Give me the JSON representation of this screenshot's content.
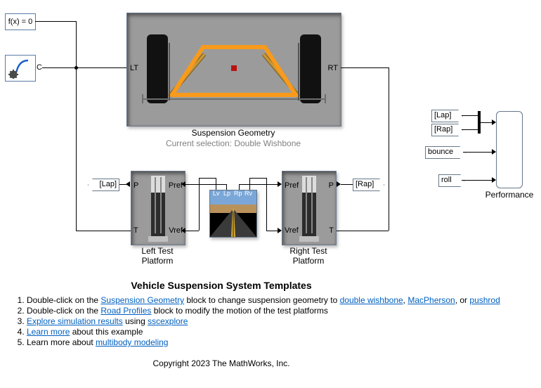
{
  "sources": {
    "fx_label": "f(x) = 0",
    "solver_tag": "C"
  },
  "geometry": {
    "caption": "Suspension Geometry",
    "subcaption": "Current selection: Double Wishbone",
    "port_left": "LT",
    "port_right": "RT"
  },
  "platforms": {
    "left": {
      "caption": "Left Test\nPlatform",
      "port_P": "P",
      "port_T": "T",
      "port_Pref": "Pref",
      "port_Vref": "Vref"
    },
    "right": {
      "caption": "Right Test\nPlatform",
      "port_P": "P",
      "port_T": "T",
      "port_Pref": "Pref",
      "port_Vref": "Vref"
    }
  },
  "road": {
    "port_Lv": "Lv",
    "port_Lp": "Lp",
    "port_Rp": "Rp",
    "port_Rv": "Rv"
  },
  "tags": {
    "lap_from": "[Lap]",
    "rap_from": "[Rap]",
    "lap_goto": "[Lap]",
    "rap_goto": "[Rap]",
    "bounce_goto": "bounce",
    "roll_goto": "roll"
  },
  "scope": {
    "caption": "Performance"
  },
  "help": {
    "title": "Vehicle Suspension System Templates",
    "lines": [
      {
        "pre": "Double-click on the ",
        "link": "Suspension Geometry",
        "mid": " block to change suspension geometry to ",
        "link2": "double wishbone",
        "mid2": ", ",
        "link3": "MacPherson",
        "mid3": ", or ",
        "link4": "pushrod",
        "post": ""
      },
      {
        "pre": "Double-click on the ",
        "link": "Road Profiles",
        "post": " block to modify the motion of the test platforms"
      },
      {
        "link": "Explore simulation results",
        "mid": " using ",
        "link2": "sscexplore",
        "post": ""
      },
      {
        "link": "Learn more",
        "post": " about this example"
      },
      {
        "pre": "Learn more about ",
        "link": "multibody modeling",
        "post": ""
      }
    ],
    "copyright": "Copyright 2023 The MathWorks, Inc."
  },
  "colors": {
    "block_bg": "#9b9b9b",
    "wheel": "#1a1a1a",
    "wishbone": "#f89a1c"
  }
}
